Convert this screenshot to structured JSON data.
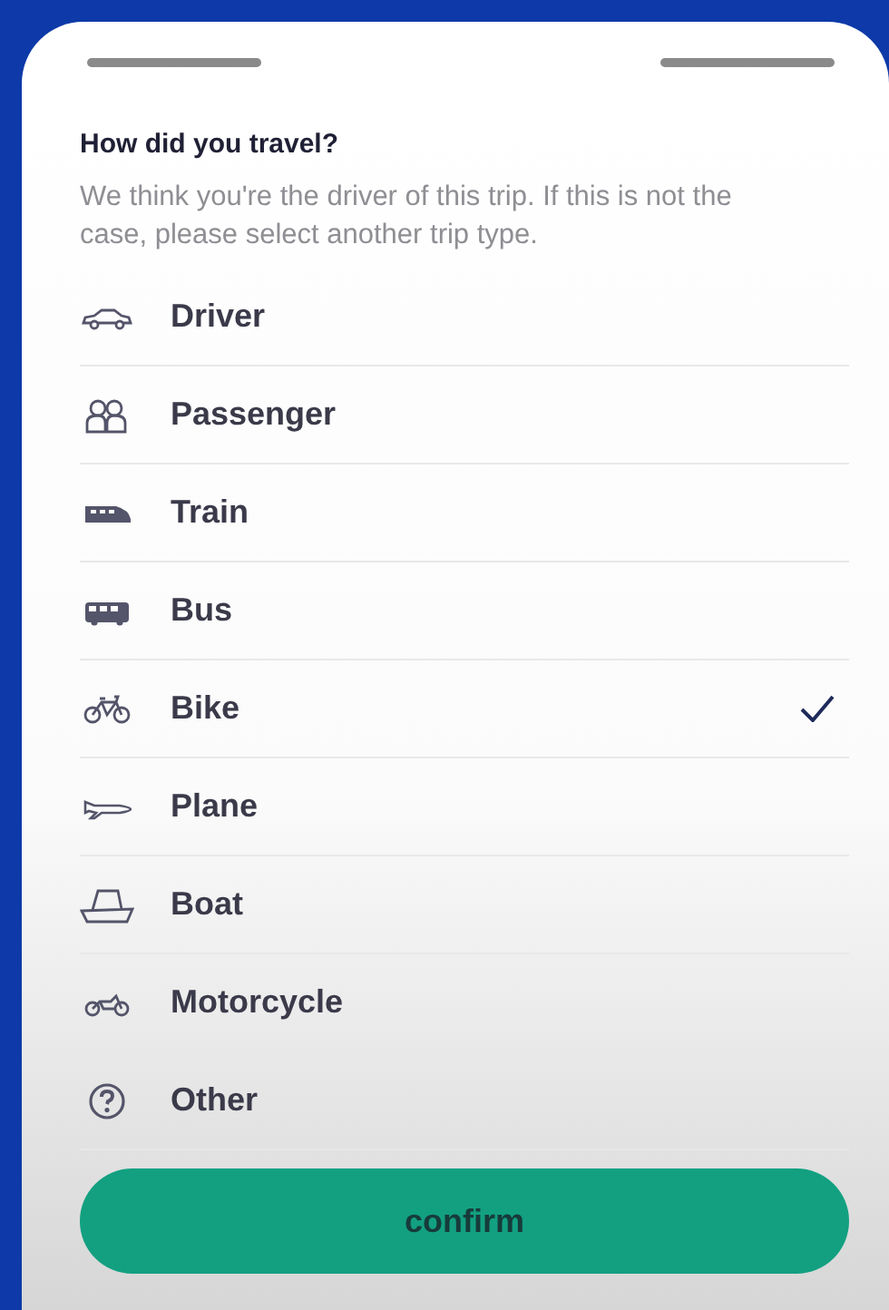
{
  "sheet": {
    "title": "How did you travel?",
    "description": "We think you're the driver of this trip. If this is not the case, please select another trip type."
  },
  "options": [
    {
      "kind": "car",
      "label": "Driver",
      "selected": false
    },
    {
      "kind": "people",
      "label": "Passenger",
      "selected": false
    },
    {
      "kind": "train",
      "label": "Train",
      "selected": false
    },
    {
      "kind": "bus",
      "label": "Bus",
      "selected": false
    },
    {
      "kind": "bike",
      "label": "Bike",
      "selected": true
    },
    {
      "kind": "plane",
      "label": "Plane",
      "selected": false
    },
    {
      "kind": "boat",
      "label": "Boat",
      "selected": false
    },
    {
      "kind": "motorcycle",
      "label": "Motorcycle",
      "selected": false
    },
    {
      "kind": "question",
      "label": "Other",
      "selected": false
    }
  ],
  "confirm_button": {
    "label": "confirm"
  }
}
